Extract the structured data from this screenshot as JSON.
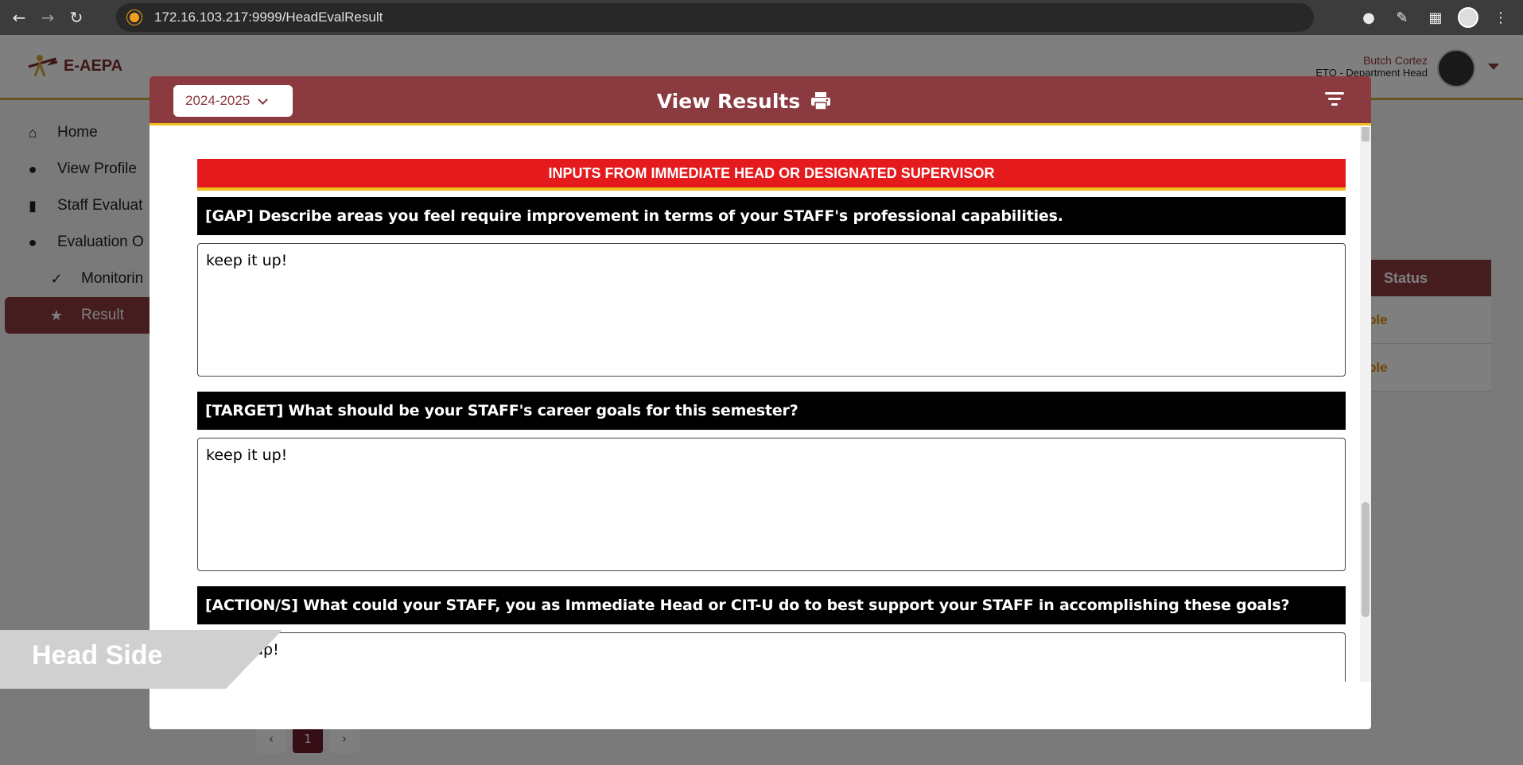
{
  "browser": {
    "url": "172.16.103.217:9999/HeadEvalResult",
    "icons": [
      "back-icon",
      "forward-icon",
      "reload-icon",
      "site-info-icon",
      "extension-icon",
      "eyedropper-icon",
      "puzzle-icon",
      "profile-icon",
      "menu-icon"
    ]
  },
  "app": {
    "logo_text": "E-AEPA",
    "user_name": "Butch Cortez",
    "user_role": "ETO - Department Head",
    "sidebar": [
      {
        "label": "Home",
        "icon": "home-icon"
      },
      {
        "label": "View Profile",
        "icon": "user-icon"
      },
      {
        "label": "Staff Evaluat",
        "icon": "document-icon"
      },
      {
        "label": "Evaluation O",
        "icon": "user-icon"
      },
      {
        "label": "Monitorin",
        "icon": "user-check-icon"
      },
      {
        "label": "Result",
        "icon": "star-icon"
      }
    ],
    "status_header": "Status",
    "status_cells": [
      "ble",
      "ble"
    ],
    "pager": {
      "prev": "‹",
      "current": "1",
      "next": "›"
    }
  },
  "modal": {
    "year": "2024-2025",
    "title": "View Results",
    "section_title": "INPUTS FROM IMMEDIATE HEAD OR DESIGNATED SUPERVISOR",
    "questions": [
      {
        "label": "[GAP] Describe areas you feel require improvement in terms of your STAFF's professional capabilities.",
        "answer": "keep it up!"
      },
      {
        "label": "[TARGET] What should be your STAFF's career goals for this semester?",
        "answer": "keep it up!"
      },
      {
        "label": "[ACTION/S] What could your STAFF, you as Immediate Head or CIT-U do to best support your STAFF in accomplishing these goals?",
        "answer": "up!"
      }
    ]
  },
  "overlay_label": "Head Side"
}
